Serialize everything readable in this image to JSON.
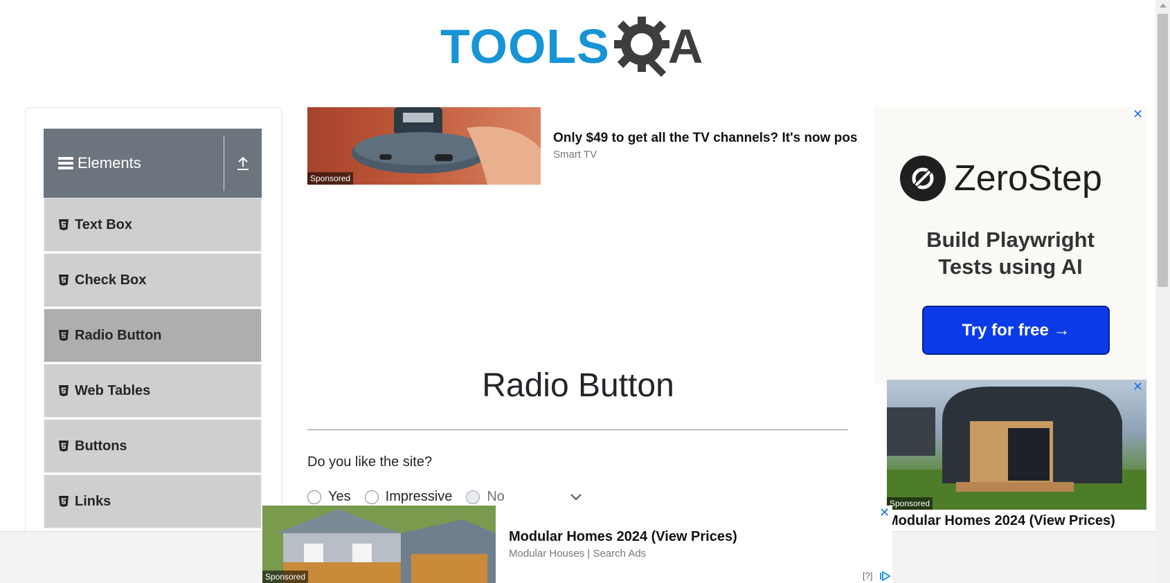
{
  "header": {
    "logo_text": "TOOLS",
    "logo_suffix": "A"
  },
  "sidebar": {
    "group_title": "Elements",
    "items": [
      {
        "label": "Text Box"
      },
      {
        "label": "Check Box"
      },
      {
        "label": "Radio Button"
      },
      {
        "label": "Web Tables"
      },
      {
        "label": "Buttons"
      },
      {
        "label": "Links"
      }
    ]
  },
  "ads": {
    "top": {
      "title": "Only $49 to get all the TV channels? It's now pos",
      "source": "Smart TV",
      "badge": "Sponsored"
    },
    "right": {
      "brand": "ZeroStep",
      "tagline_1": "Build Playwright",
      "tagline_2": "Tests using AI",
      "cta": "Try for free →",
      "close": "✕"
    },
    "right2": {
      "title": "Modular Homes 2024 (View Prices)",
      "badge": "Sponsored",
      "close": "✕"
    },
    "bottom": {
      "title": "Modular Homes 2024 (View Prices)",
      "source": "Modular Houses | Search Ads",
      "badge": "Sponsored",
      "close": "✕",
      "help": "[?]"
    }
  },
  "main": {
    "title": "Radio Button",
    "question": "Do you like the site?",
    "options": [
      {
        "label": "Yes",
        "disabled": false
      },
      {
        "label": "Impressive",
        "disabled": false
      },
      {
        "label": "No",
        "disabled": true
      }
    ]
  },
  "colors": {
    "brand_blue": "#1694d6",
    "sidebar_header": "#6c757d",
    "menu_item": "#cfcfcf",
    "menu_active": "#aeaeae",
    "cta_blue": "#0b3be8"
  }
}
